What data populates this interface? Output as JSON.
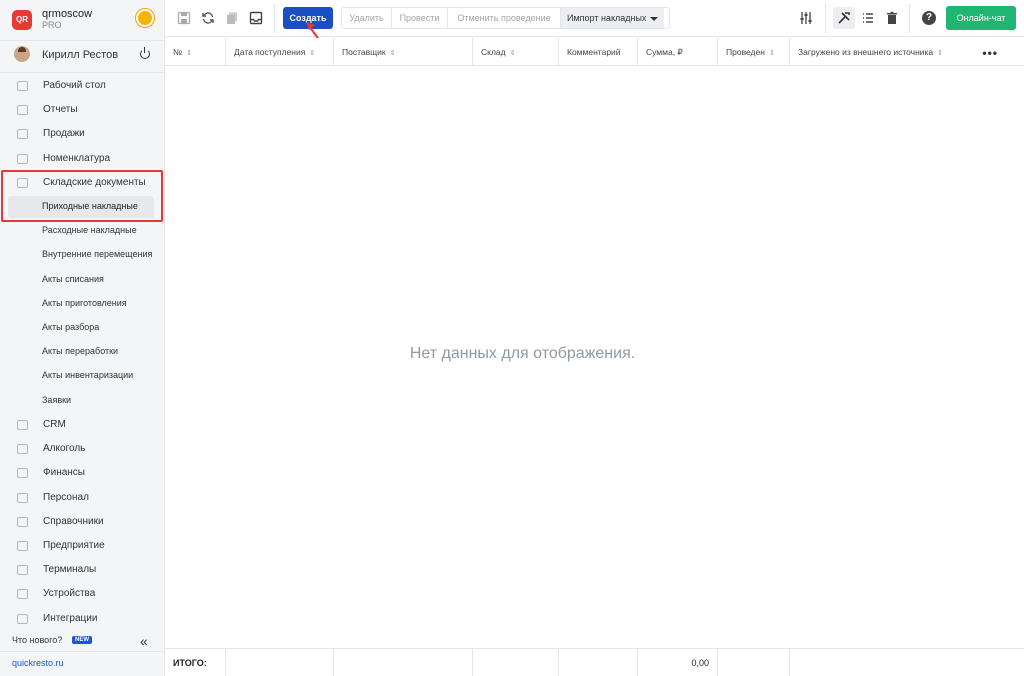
{
  "brand": {
    "logo_text": "QR",
    "name": "qrmoscow",
    "plan": "PRO"
  },
  "user": {
    "name": "Кирилл Рестов"
  },
  "nav": [
    {
      "label": "Рабочий стол",
      "icon": "dashboard-icon"
    },
    {
      "label": "Отчеты",
      "icon": "reports-icon"
    },
    {
      "label": "Продажи",
      "icon": "sales-icon"
    },
    {
      "label": "Номенклатура",
      "icon": "nomenclature-icon"
    },
    {
      "label": "Складские документы",
      "icon": "warehouse-icon"
    }
  ],
  "subnav": [
    {
      "label": "Приходные накладные",
      "active": true
    },
    {
      "label": "Расходные накладные"
    },
    {
      "label": "Внутренние перемещения"
    },
    {
      "label": "Акты списания"
    },
    {
      "label": "Акты приготовления"
    },
    {
      "label": "Акты разбора"
    },
    {
      "label": "Акты переработки"
    },
    {
      "label": "Акты инвентаризации"
    },
    {
      "label": "Заявки"
    }
  ],
  "nav2": [
    {
      "label": "CRM",
      "icon": "crm-icon"
    },
    {
      "label": "Алкоголь",
      "icon": "alcohol-icon"
    },
    {
      "label": "Финансы",
      "icon": "finance-icon"
    },
    {
      "label": "Персонал",
      "icon": "staff-icon"
    },
    {
      "label": "Справочники",
      "icon": "reference-icon"
    },
    {
      "label": "Предприятие",
      "icon": "enterprise-icon"
    },
    {
      "label": "Терминалы",
      "icon": "terminal-icon"
    },
    {
      "label": "Устройства",
      "icon": "devices-icon"
    },
    {
      "label": "Интеграции",
      "icon": "integrations-icon"
    }
  ],
  "footer_sidebar": {
    "whats_new": "Что нового?",
    "new_badge": "NEW",
    "site": "quickresto.ru"
  },
  "toolbar": {
    "create": "Создать",
    "delete": "Удалить",
    "post": "Провести",
    "cancel_post": "Отменить проведение",
    "import": "Импорт накладных",
    "online_chat": "Онлайн-чат"
  },
  "table": {
    "columns": [
      "№",
      "Дата поступления",
      "Поставщик",
      "Склад",
      "Комментарий",
      "Сумма, ₽",
      "Проведен",
      "Загружено из внешнего источника"
    ],
    "empty": "Нет данных для отображения.",
    "total_label": "ИТОГО:",
    "total_sum": "0,00"
  }
}
